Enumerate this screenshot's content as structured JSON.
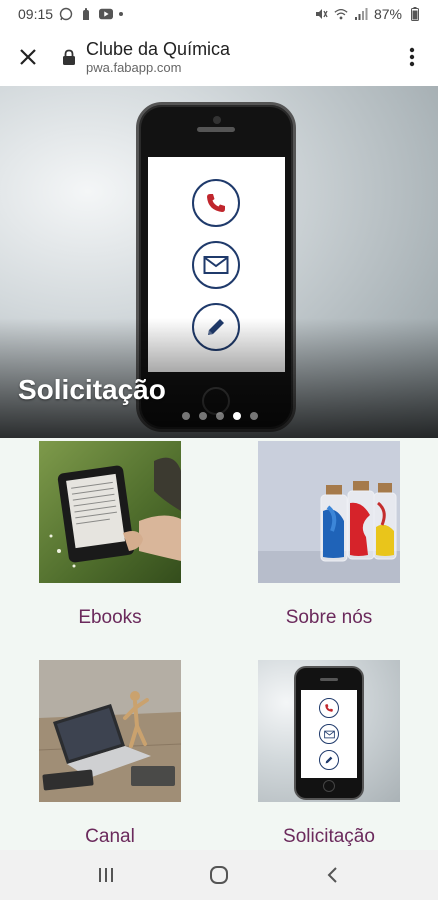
{
  "status_bar": {
    "time": "09:15",
    "battery": "87%",
    "left_icons": [
      "whatsapp-icon",
      "hand-icon",
      "youtube-icon",
      "dot-icon"
    ],
    "right_icons": [
      "mute-icon",
      "wifi-icon",
      "signal-icon"
    ]
  },
  "browser": {
    "title": "Clube da Química",
    "url": "pwa.fabapp.com",
    "close_icon": "close-icon",
    "lock_icon": "lock-icon",
    "menu_icon": "more-vert-icon"
  },
  "hero": {
    "title": "Solicitação",
    "slide_count": 5,
    "active_slide": 4,
    "icons": [
      "phone-icon",
      "envelope-icon",
      "pencil-icon"
    ],
    "colors": {
      "phone_icon": "#c0262d",
      "envelope_icon": "#1f3a6b",
      "pencil_icon": "#1f3a6b"
    }
  },
  "grid": {
    "items": [
      {
        "label": "Ebooks",
        "image": "ereader-image"
      },
      {
        "label": "Sobre nós",
        "image": "ink-bottles-image"
      },
      {
        "label": "Canal",
        "image": "laptop-desk-image"
      },
      {
        "label": "Solicitação",
        "image": "phone-contact-image"
      }
    ],
    "label_color": "#6b2a5c",
    "background": "#f2f7f3"
  },
  "nav": {
    "buttons": [
      "recent-apps-icon",
      "home-icon",
      "back-icon"
    ]
  }
}
